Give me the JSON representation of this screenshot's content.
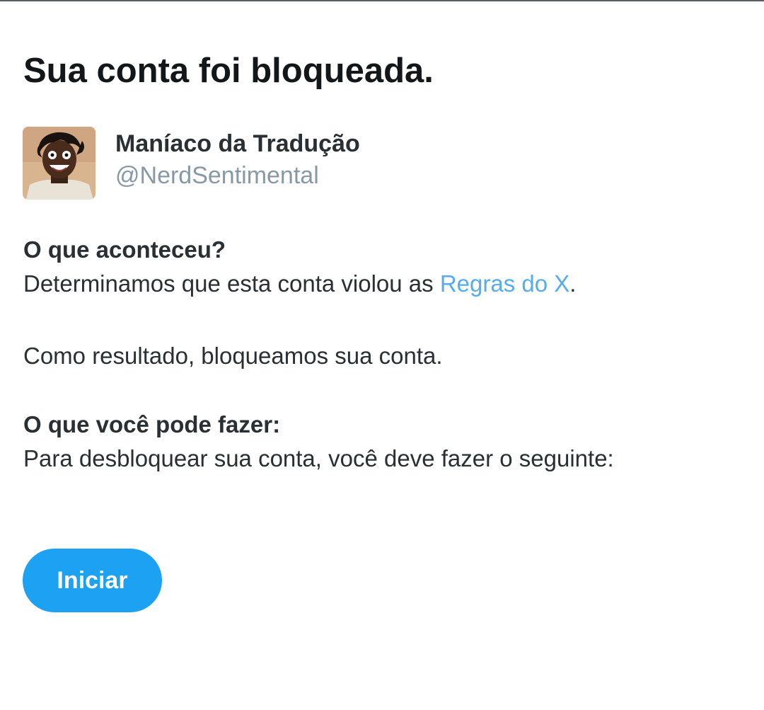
{
  "page": {
    "title": "Sua conta foi bloqueada."
  },
  "account": {
    "display_name": "Maníaco da Tradução",
    "handle": "@NerdSentimental"
  },
  "what_happened": {
    "heading": "O que aconteceu?",
    "text_before_link": "Determinamos que esta conta violou as ",
    "link_label": "Regras do X",
    "text_after_link": ".",
    "result_text": "Como resultado, bloqueamos sua conta."
  },
  "what_you_can_do": {
    "heading": "O que você pode fazer:",
    "text": "Para desbloquear sua conta, você deve fazer o seguinte:"
  },
  "actions": {
    "start_label": "Iniciar"
  },
  "colors": {
    "accent": "#1da1f2",
    "link": "#55acee",
    "muted": "#8899a6",
    "text": "#292f33"
  }
}
